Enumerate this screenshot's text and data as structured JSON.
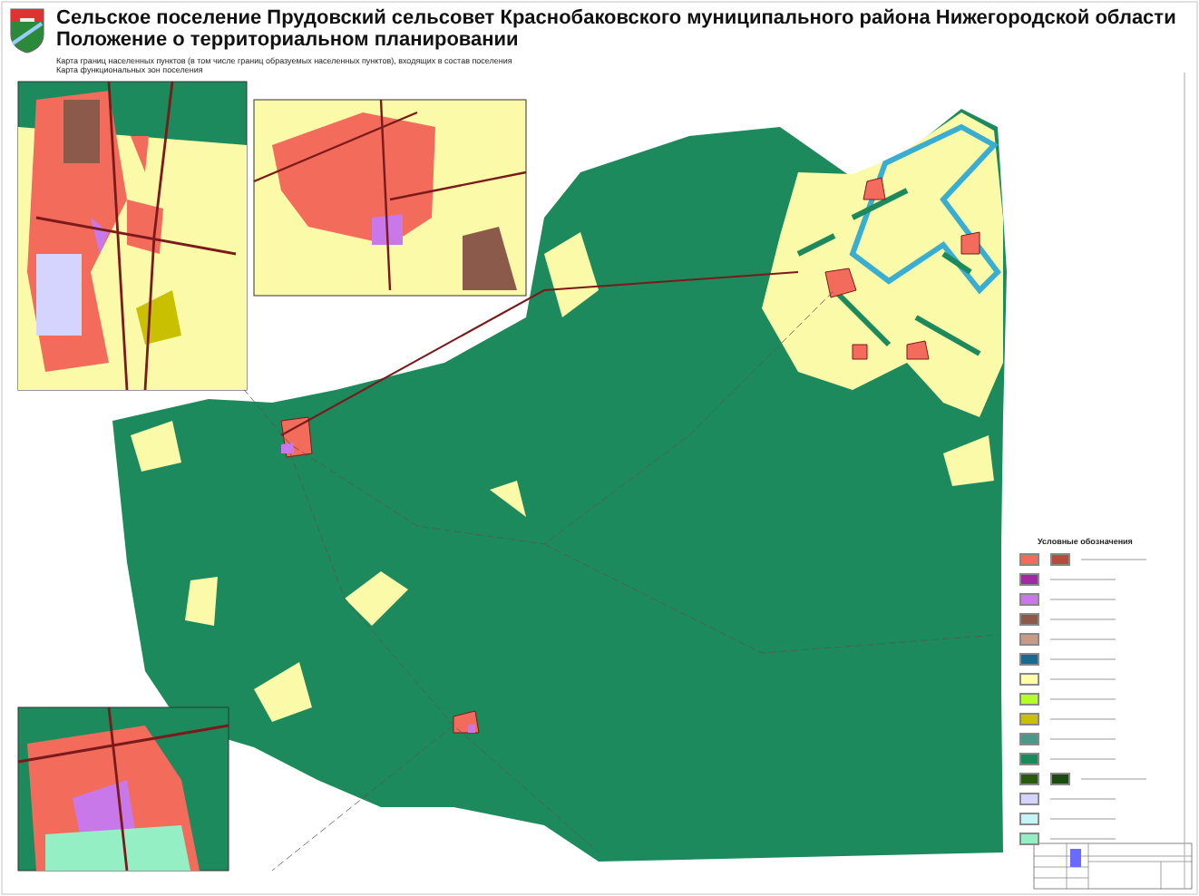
{
  "header": {
    "title": "Сельское поселение Прудовский сельсовет Краснобаковского муниципального района Нижегородской области",
    "subtitle": "Положение о территориальном планировании",
    "notes": [
      "Карта границ населенных пунктов (в том числе границ образуемых населенных пунктов), входящих в состав поселения",
      "Карта функциональных зон поселения"
    ]
  },
  "legend": {
    "title": "Условные обозначения",
    "items": [
      {
        "color": "#f26b5b",
        "symbols": [
          {
            "color": "#b84a3c"
          }
        ]
      },
      {
        "color": "#a02aa0"
      },
      {
        "color": "#c878e8"
      },
      {
        "color": "#8b5a4a"
      },
      {
        "color": "#c89a88"
      },
      {
        "color": "#1a6a90"
      },
      {
        "color": "#ffffa8"
      },
      {
        "color": "#b4ff28"
      },
      {
        "color": "#c8c000"
      },
      {
        "color": "#4a9a8a"
      },
      {
        "color": "#1a8a5a"
      },
      {
        "color": "#2a5a10",
        "symbols": [
          {
            "color": "#1a4a10"
          }
        ]
      },
      {
        "color": "#d4d4ff"
      },
      {
        "color": "#c4f4f4"
      },
      {
        "color": "#94f0c4"
      }
    ]
  }
}
